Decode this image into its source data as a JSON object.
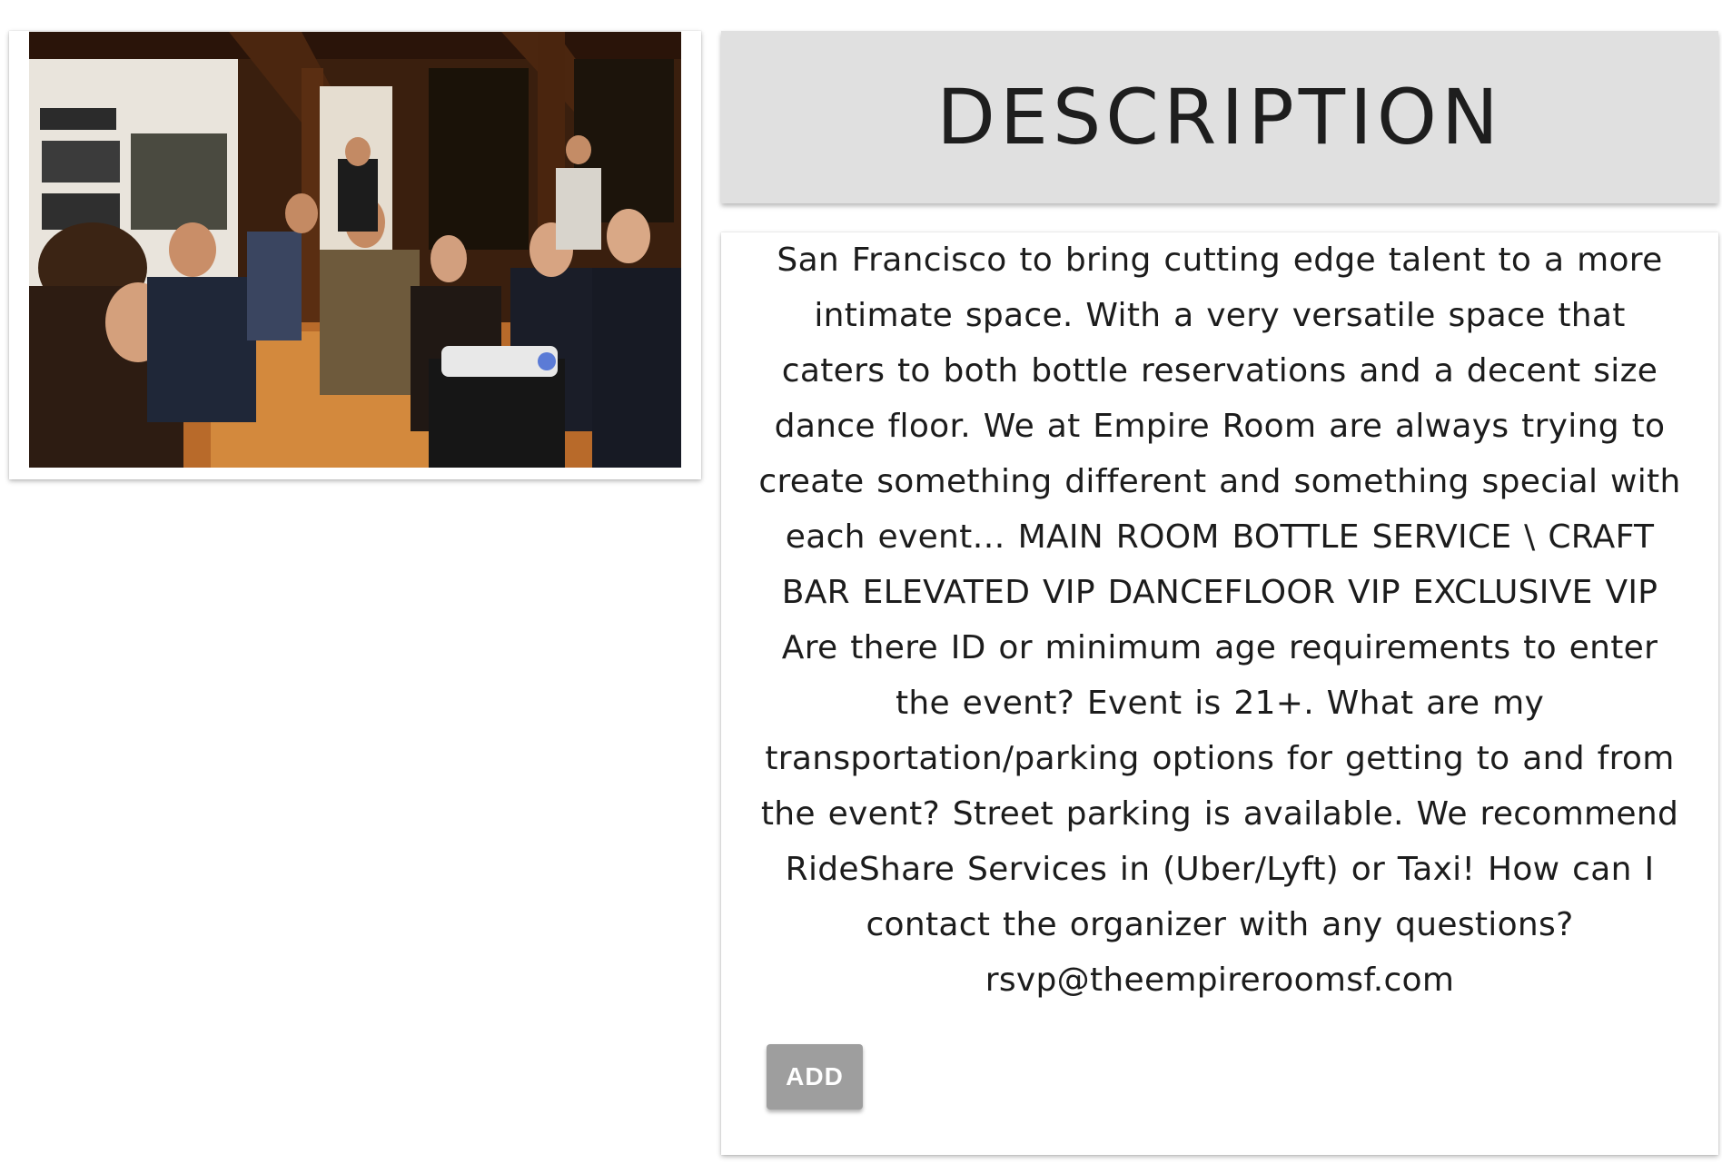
{
  "photo": {
    "alt": "Audience seated in a wood-beamed event space"
  },
  "description": {
    "title": "DESCRIPTION",
    "text": "San Francisco to bring cutting edge talent to a more intimate space. With a very versatile space that caters to both bottle reservations and a decent size dance floor. We at Empire Room are always trying to create something different and something special with each event…  MAIN ROOM BOTTLE SERVICE \\ CRAFT BAR  ELEVATED VIP DANCEFLOOR VIP EXCLUSIVE VIP Are there ID or minimum age requirements to enter the event? Event is 21+.   What are my transportation/parking options for getting to and from the event? Street parking is available. We recommend RideShare Services in (Uber/Lyft) or Taxi!   How can I contact the organizer with any questions? rsvp@theempireroomsf.com",
    "add_label": "ADD"
  },
  "colors": {
    "header_bg": "#e0e0e0",
    "button_bg": "#9e9e9e",
    "text": "#1c1c1c"
  }
}
